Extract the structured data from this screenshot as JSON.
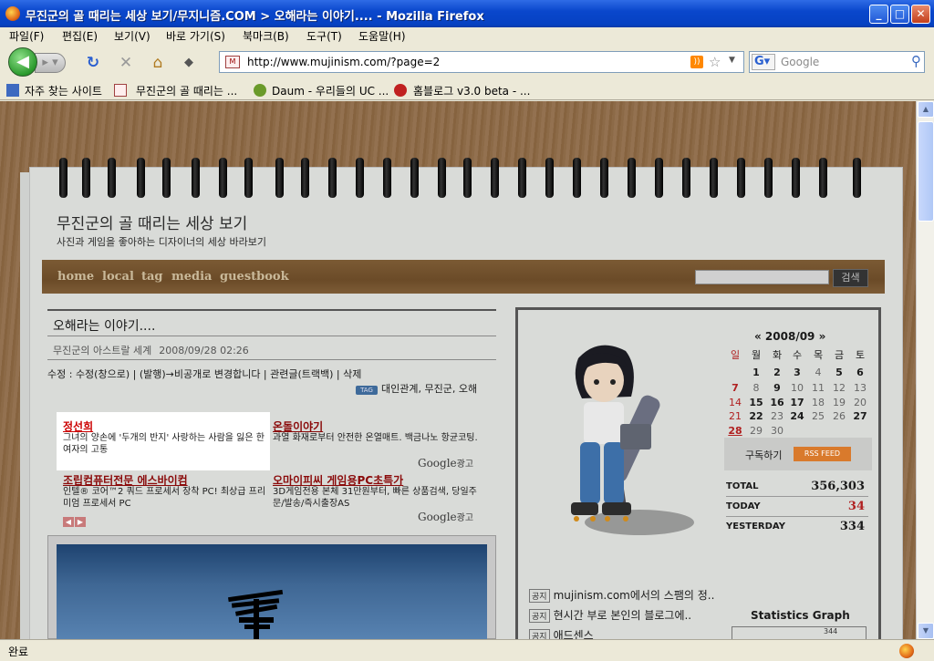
{
  "window": {
    "title": "무진군의 골 때리는 세상 보기/무지니즘.COM > 오해라는 이야기.... - Mozilla Firefox"
  },
  "menu": [
    "파일(F)",
    "편집(E)",
    "보기(V)",
    "바로 가기(S)",
    "북마크(B)",
    "도구(T)",
    "도움말(H)"
  ],
  "nav": {
    "url": "http://www.mujinism.com/?page=2",
    "search_placeholder": "Google"
  },
  "bookmarks": [
    "자주 찾는 사이트",
    "무진군의 골 때리는 ...",
    "Daum - 우리들의 UC ...",
    "홈블로그 v3.0 beta - ..."
  ],
  "status": "완료",
  "blog": {
    "title": "무진군의 골 때리는 세상 보기",
    "subtitle": "사진과 게임을 좋아하는 디자이너의 세상 바라보기",
    "nav": [
      "home",
      "local",
      "tag",
      "media",
      "guestbook"
    ],
    "search_button": "검색"
  },
  "post": {
    "title": "오해라는 이야기....",
    "category": "무진군의 아스트랄 세계",
    "date": "2008/09/28 02:26",
    "actions": "수정 : 수정(창으로) | (발행)→비공개로 변경합니다 | 관련글(트랙백) | 삭제",
    "tag_label": "TAG",
    "tags": "대인관계, 무진군, 오해"
  },
  "ads": [
    {
      "title": "정선희",
      "desc": "그녀의 양손에 '두개의 반지' 사랑하는 사람을 잃은 한여자의 고통"
    },
    {
      "title": "온돌이야기",
      "desc": "과열 화재로부터 안전한 온열매트. 백금나노 항균코팅."
    },
    {
      "title": "조립컴퓨터전문 에스바이컴",
      "desc": "인텔® 코어™2 쿼드 프로세서 장착 PC! 최상급 프리미엄 프로세서 PC"
    },
    {
      "title": "오마이피씨 게임용PC초특가",
      "desc": "3D게임전용 본체 31만원부터, 빠른 상품검색, 당일주문/발송/즉시출장AS"
    }
  ],
  "google_ads_label": {
    "brand": "Google",
    "suffix": "광고"
  },
  "calendar": {
    "header": "«   2008/09   »",
    "weekdays": [
      "일",
      "월",
      "화",
      "수",
      "목",
      "금",
      "토"
    ],
    "weeks": [
      [
        "",
        "1",
        "2",
        "3",
        "4",
        "5",
        "6"
      ],
      [
        "7",
        "8",
        "9",
        "10",
        "11",
        "12",
        "13"
      ],
      [
        "14",
        "15",
        "16",
        "17",
        "18",
        "19",
        "20"
      ],
      [
        "21",
        "22",
        "23",
        "24",
        "25",
        "26",
        "27"
      ],
      [
        "28",
        "29",
        "30",
        "",
        "",
        "",
        ""
      ]
    ]
  },
  "subscribe": {
    "label": "구독하기",
    "rss": "RSS FEED"
  },
  "counter": [
    {
      "label": "TOTAL",
      "value": "356,303"
    },
    {
      "label": "TODAY",
      "value": "34"
    },
    {
      "label": "YESTERDAY",
      "value": "334"
    }
  ],
  "notices": [
    {
      "tag": "공지",
      "text": "mujinism.com에서의 스팸의 정.."
    },
    {
      "tag": "공지",
      "text": "현시간 부로 본인의 블로그에.."
    },
    {
      "tag": "공지",
      "text": "애드센스"
    }
  ],
  "stats": {
    "title": "Statistics Graph",
    "peak": "344"
  }
}
